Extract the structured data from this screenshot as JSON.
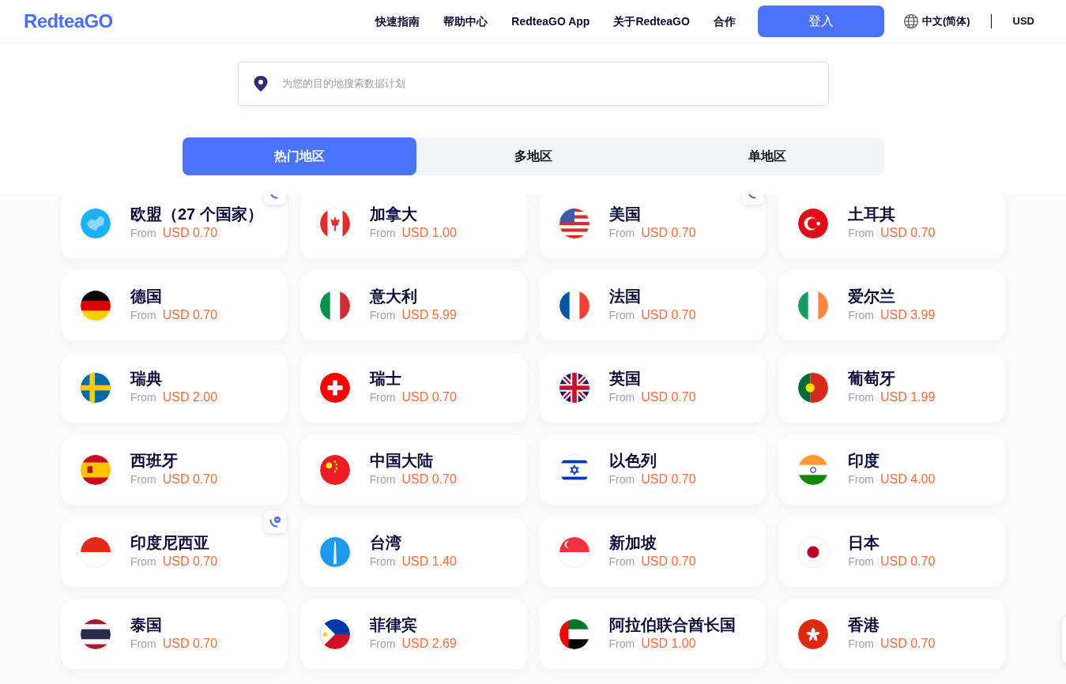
{
  "header": {
    "logo": "RedteaGO",
    "nav": [
      "快速指南",
      "帮助中心",
      "RedteaGO App",
      "关于RedteaGO",
      "合作"
    ],
    "login": "登入",
    "language": "中文(简体)",
    "currency": "USD"
  },
  "search": {
    "placeholder": "为您的目的地搜索数据计划"
  },
  "tabs": [
    {
      "label": "热门地区",
      "selected": true
    },
    {
      "label": "多地区",
      "selected": false
    },
    {
      "label": "单地区",
      "selected": false
    }
  ],
  "destinations": [
    {
      "kind": "eu",
      "name": "欧盟（27 个国家）",
      "from": "From",
      "price": "USD 0.70",
      "chat_badge": true
    },
    {
      "kind": "ca",
      "name": "加拿大",
      "from": "From",
      "price": "USD 1.00",
      "chat_badge": false
    },
    {
      "kind": "us",
      "name": "美国",
      "from": "From",
      "price": "USD 0.70",
      "chat_badge": true
    },
    {
      "kind": "tr",
      "name": "土耳其",
      "from": "From",
      "price": "USD 0.70",
      "chat_badge": false
    },
    {
      "kind": "de",
      "name": "德国",
      "from": "From",
      "price": "USD 0.70",
      "chat_badge": false
    },
    {
      "kind": "it",
      "name": "意大利",
      "from": "From",
      "price": "USD 5.99",
      "chat_badge": false
    },
    {
      "kind": "fr",
      "name": "法国",
      "from": "From",
      "price": "USD 0.70",
      "chat_badge": false
    },
    {
      "kind": "ie",
      "name": "爱尔兰",
      "from": "From",
      "price": "USD 3.99",
      "chat_badge": false
    },
    {
      "kind": "se",
      "name": "瑞典",
      "from": "From",
      "price": "USD 2.00",
      "chat_badge": false
    },
    {
      "kind": "ch",
      "name": "瑞士",
      "from": "From",
      "price": "USD 0.70",
      "chat_badge": false
    },
    {
      "kind": "gb",
      "name": "英国",
      "from": "From",
      "price": "USD 0.70",
      "chat_badge": false
    },
    {
      "kind": "pt",
      "name": "葡萄牙",
      "from": "From",
      "price": "USD 1.99",
      "chat_badge": false
    },
    {
      "kind": "es",
      "name": "西班牙",
      "from": "From",
      "price": "USD 0.70",
      "chat_badge": false
    },
    {
      "kind": "cn",
      "name": "中国大陆",
      "from": "From",
      "price": "USD 0.70",
      "chat_badge": false
    },
    {
      "kind": "il",
      "name": "以色列",
      "from": "From",
      "price": "USD 0.70",
      "chat_badge": false
    },
    {
      "kind": "in",
      "name": "印度",
      "from": "From",
      "price": "USD 4.00",
      "chat_badge": false
    },
    {
      "kind": "id",
      "name": "印度尼西亚",
      "from": "From",
      "price": "USD 0.70",
      "chat_badge": true
    },
    {
      "kind": "tw",
      "name": "台湾",
      "from": "From",
      "price": "USD 1.40",
      "chat_badge": false
    },
    {
      "kind": "sg",
      "name": "新加坡",
      "from": "From",
      "price": "USD 0.70",
      "chat_badge": false
    },
    {
      "kind": "jp",
      "name": "日本",
      "from": "From",
      "price": "USD 0.70",
      "chat_badge": false
    },
    {
      "kind": "th",
      "name": "泰国",
      "from": "From",
      "price": "USD 0.70",
      "chat_badge": false
    },
    {
      "kind": "ph",
      "name": "菲律宾",
      "from": "From",
      "price": "USD 2.69",
      "chat_badge": false
    },
    {
      "kind": "ae",
      "name": "阿拉伯联合酋长国",
      "from": "From",
      "price": "USD 1.00",
      "chat_badge": false
    },
    {
      "kind": "hk",
      "name": "香港",
      "from": "From",
      "price": "USD 0.70",
      "chat_badge": false
    }
  ]
}
